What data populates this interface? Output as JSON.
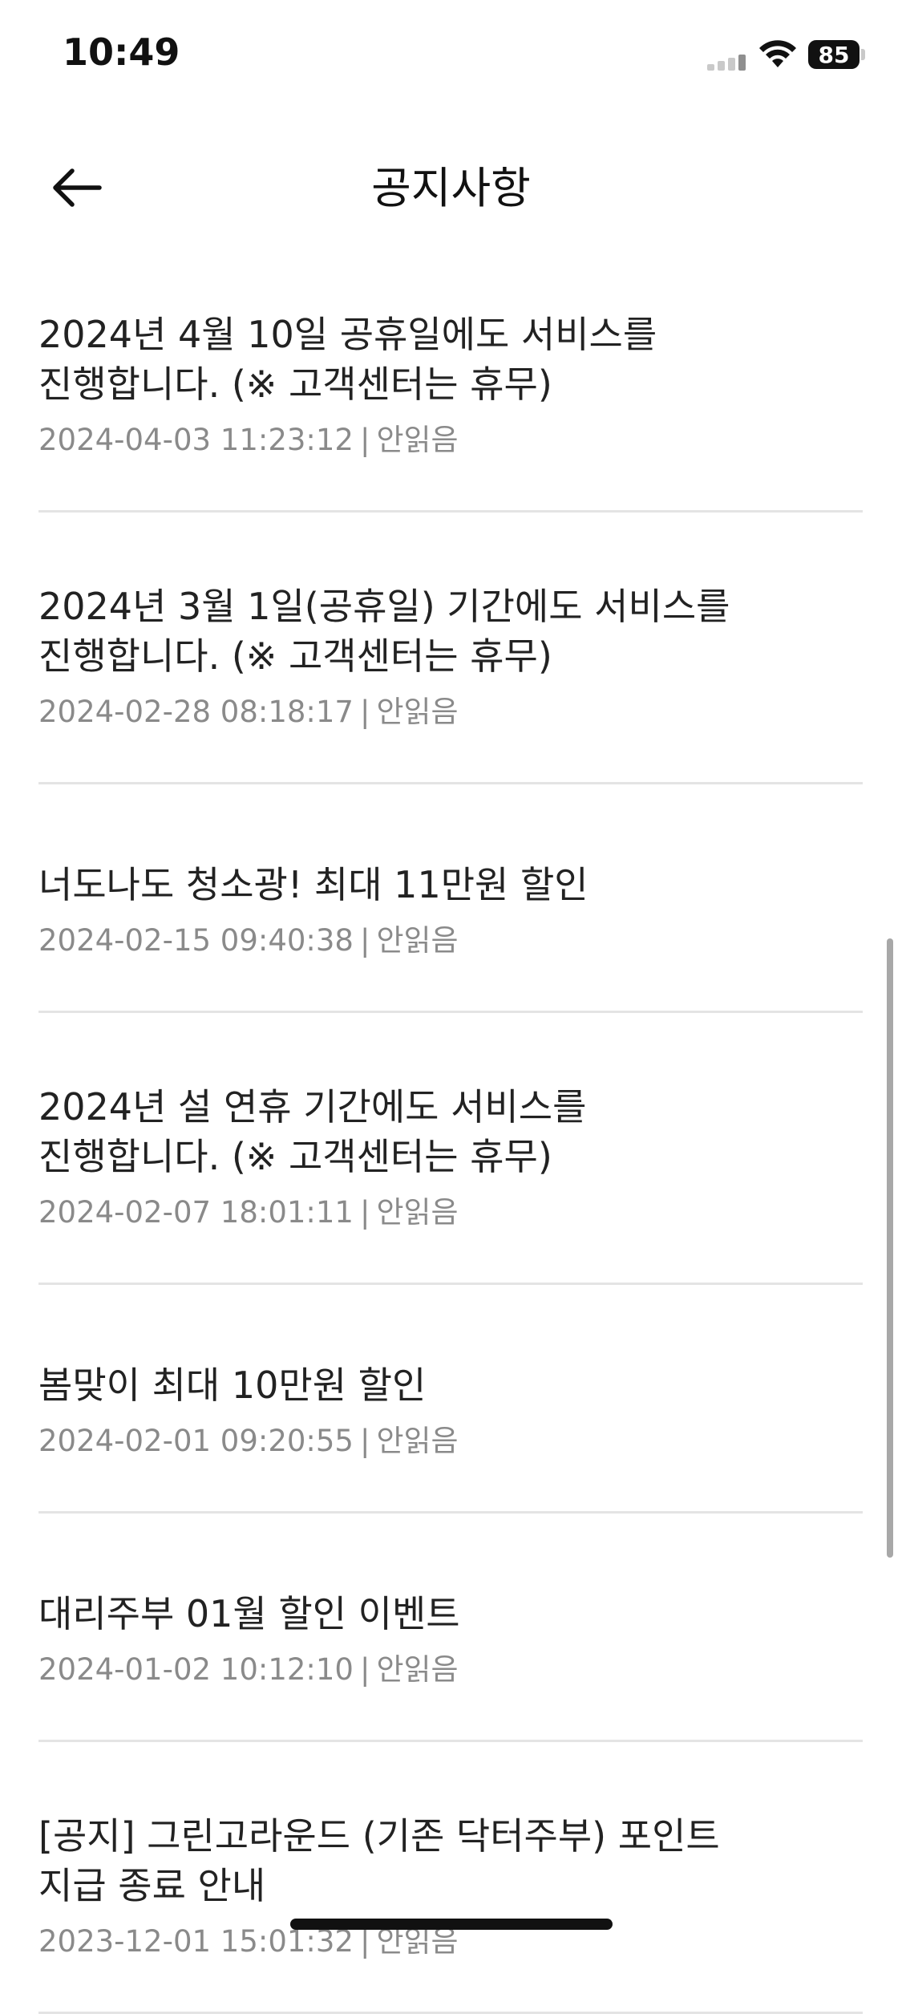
{
  "status_bar": {
    "time": "10:49",
    "battery_level": "85",
    "icons": [
      "cellular-signal-icon",
      "wifi-icon",
      "battery-icon"
    ]
  },
  "header": {
    "title": "공지사항",
    "back_icon": "arrow-left-icon"
  },
  "notices": [
    {
      "title": "2024년 4월 10일 공휴일에도 서비스를\n진행합니다. (※ 고객센터는 휴무)",
      "date": "2024-04-03 11:23:12",
      "status": "안읽음"
    },
    {
      "title": "2024년 3월 1일(공휴일) 기간에도 서비스를\n진행합니다. (※ 고객센터는 휴무)",
      "date": "2024-02-28 08:18:17",
      "status": "안읽음"
    },
    {
      "title": "너도나도 청소광! 최대 11만원 할인",
      "date": "2024-02-15 09:40:38",
      "status": "안읽음"
    },
    {
      "title": "2024년 설 연휴 기간에도 서비스를\n진행합니다. (※ 고객센터는 휴무)",
      "date": "2024-02-07 18:01:11",
      "status": "안읽음"
    },
    {
      "title": "봄맞이 최대 10만원 할인",
      "date": "2024-02-01 09:20:55",
      "status": "안읽음"
    },
    {
      "title": "대리주부 01월 할인 이벤트",
      "date": "2024-01-02 10:12:10",
      "status": "안읽음"
    },
    {
      "title": "[공지] 그린고라운드 (기존 닥터주부) 포인트\n지급 종료 안내",
      "date": "2023-12-01 15:01:32",
      "status": "안읽음"
    }
  ],
  "colors": {
    "text_primary": "#222222",
    "text_secondary": "#8a8a8a",
    "divider": "#e4e4e4",
    "background": "#ffffff"
  }
}
